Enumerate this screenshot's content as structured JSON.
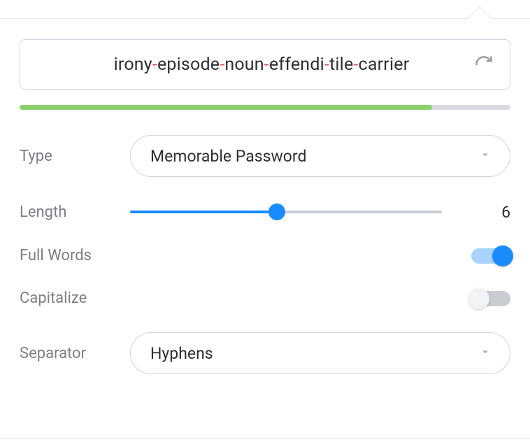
{
  "password": {
    "words": [
      "irony",
      "episode",
      "noun",
      "effendi",
      "tile",
      "carrier"
    ],
    "separator_char": "-"
  },
  "strength_percent": 84,
  "labels": {
    "type": "Type",
    "length": "Length",
    "full_words": "Full Words",
    "capitalize": "Capitalize",
    "separator": "Separator"
  },
  "type": {
    "selected": "Memorable Password"
  },
  "length": {
    "value": "6",
    "percent": 47
  },
  "full_words": {
    "on": true
  },
  "capitalize": {
    "on": false
  },
  "separator": {
    "selected": "Hyphens"
  }
}
